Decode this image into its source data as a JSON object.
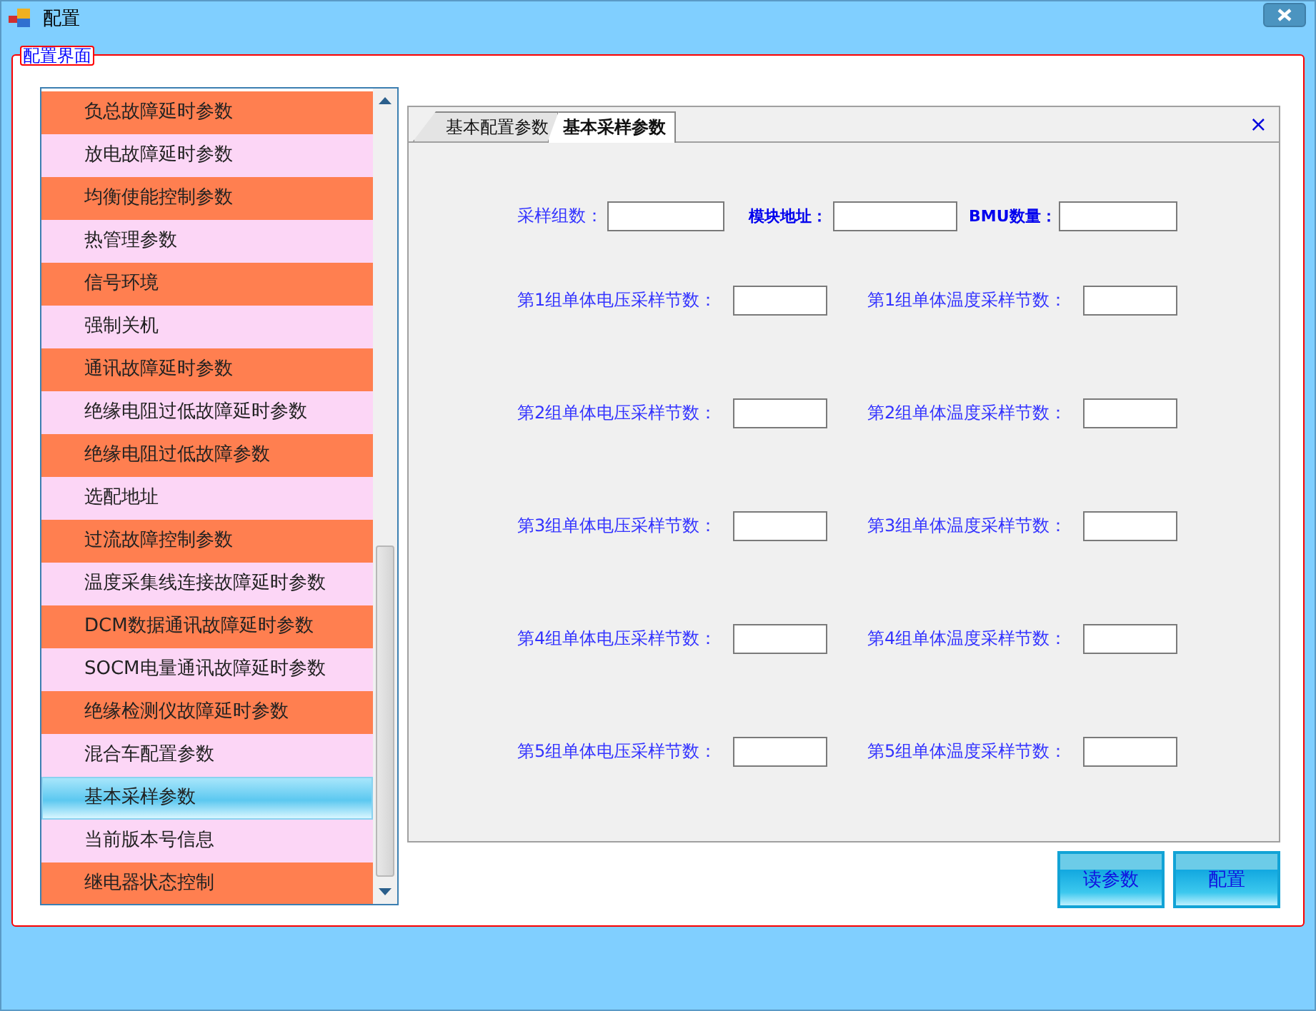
{
  "window": {
    "title": "配置"
  },
  "group": {
    "title": "配置界面"
  },
  "menu_list": {
    "items": [
      {
        "label": "负总故障延时参数",
        "color": "#ff7f50",
        "selected": false
      },
      {
        "label": "放电故障延时参数",
        "color": "#fcd6f6",
        "selected": false
      },
      {
        "label": "均衡使能控制参数",
        "color": "#ff7f50",
        "selected": false
      },
      {
        "label": "热管理参数",
        "color": "#fcd6f6",
        "selected": false
      },
      {
        "label": "信号环境",
        "color": "#ff7f50",
        "selected": false
      },
      {
        "label": "强制关机",
        "color": "#fcd6f6",
        "selected": false
      },
      {
        "label": "通讯故障延时参数",
        "color": "#ff7f50",
        "selected": false
      },
      {
        "label": "绝缘电阻过低故障延时参数",
        "color": "#fcd6f6",
        "selected": false
      },
      {
        "label": "绝缘电阻过低故障参数",
        "color": "#ff7f50",
        "selected": false
      },
      {
        "label": "选配地址",
        "color": "#fcd6f6",
        "selected": false
      },
      {
        "label": "过流故障控制参数",
        "color": "#ff7f50",
        "selected": false
      },
      {
        "label": "温度采集线连接故障延时参数",
        "color": "#fcd6f6",
        "selected": false
      },
      {
        "label": "DCM数据通讯故障延时参数",
        "color": "#ff7f50",
        "selected": false
      },
      {
        "label": "SOCM电量通讯故障延时参数",
        "color": "#fcd6f6",
        "selected": false
      },
      {
        "label": "绝缘检测仪故障延时参数",
        "color": "#ff7f50",
        "selected": false
      },
      {
        "label": "混合车配置参数",
        "color": "#fcd6f6",
        "selected": false
      },
      {
        "label": "基本采样参数",
        "selected": true
      },
      {
        "label": "当前版本号信息",
        "color": "#fcd6f6",
        "selected": false
      },
      {
        "label": "继电器状态控制",
        "color": "#ff7f50",
        "selected": false
      }
    ]
  },
  "tabs": [
    {
      "label": "基本配置参数",
      "selected": false
    },
    {
      "label": "基本采样参数",
      "selected": true
    }
  ],
  "tab_close": "×",
  "form": {
    "top_row": [
      {
        "label": "采样组数：",
        "bold": false
      },
      {
        "label": "模块地址：",
        "bold": true
      },
      {
        "label": "BMU数量：",
        "bold": true
      }
    ],
    "group_rows": [
      {
        "voltage_label": "第1组单体电压采样节数：",
        "temperature_label": "第1组单体温度采样节数："
      },
      {
        "voltage_label": "第2组单体电压采样节数：",
        "temperature_label": "第2组单体温度采样节数："
      },
      {
        "voltage_label": "第3组单体电压采样节数：",
        "temperature_label": "第3组单体温度采样节数："
      },
      {
        "voltage_label": "第4组单体电压采样节数：",
        "temperature_label": "第4组单体温度采样节数："
      },
      {
        "voltage_label": "第5组单体电压采样节数：",
        "temperature_label": "第5组单体温度采样节数："
      }
    ]
  },
  "buttons": [
    "读参数",
    "配置"
  ]
}
